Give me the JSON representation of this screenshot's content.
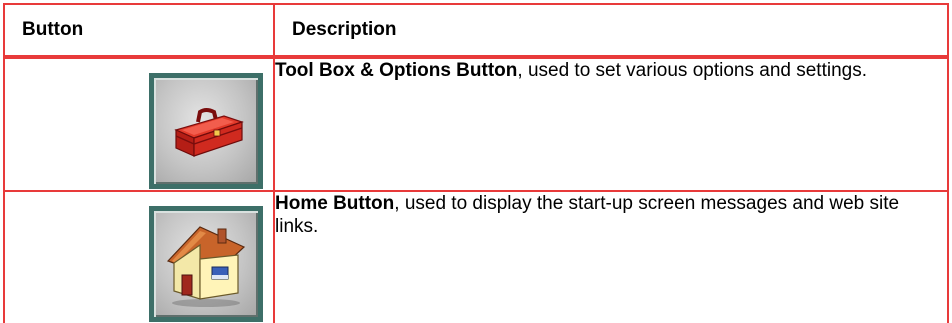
{
  "table": {
    "headers": [
      "Button",
      "Description"
    ],
    "rows": [
      {
        "icon": "toolbox-icon",
        "title": "Tool Box & Options Button",
        "description": ", used to set various options and settings."
      },
      {
        "icon": "home-icon",
        "title": "Home Button",
        "description": ", used to display the start-up screen messages and web site links."
      }
    ]
  },
  "colors": {
    "border": "#e83a3a",
    "button_frame": "#3d6f68"
  }
}
